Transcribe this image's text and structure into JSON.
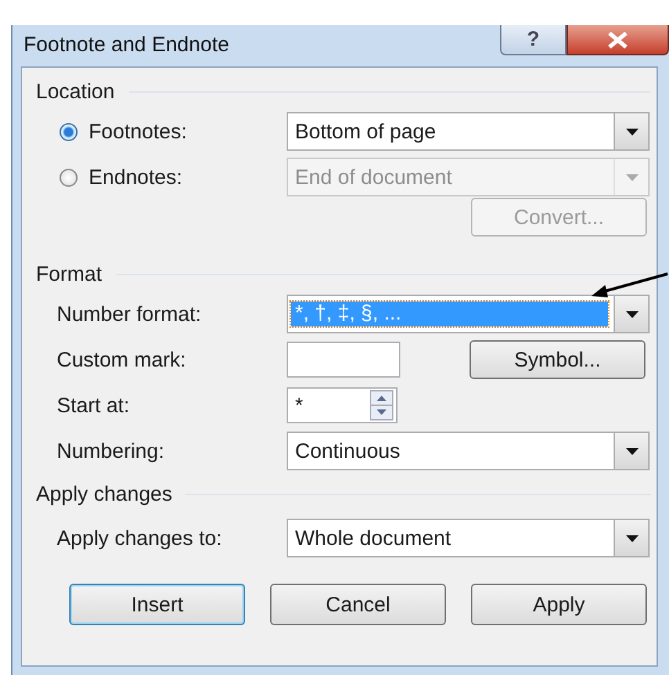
{
  "window": {
    "title": "Footnote and Endnote",
    "help_label": "?"
  },
  "location": {
    "legend": "Location",
    "rows": [
      {
        "kind": "radio",
        "label": "Footnotes:",
        "selected": true,
        "value": "Bottom of page",
        "disabled": false
      },
      {
        "kind": "radio",
        "label": "Endnotes:",
        "selected": false,
        "value": "End of document",
        "disabled": true
      }
    ],
    "convert_button": {
      "label": "Convert...",
      "disabled": true
    }
  },
  "format": {
    "legend": "Format",
    "rows": [
      {
        "kind": "dropdown",
        "label": "Number format:",
        "value": "*, †, ‡, §, ...",
        "focused": true
      },
      {
        "kind": "text",
        "label": "Custom mark:",
        "button": {
          "label": "Symbol..."
        }
      },
      {
        "kind": "spinner",
        "label": "Start at:",
        "value": "*"
      },
      {
        "kind": "dropdown",
        "label": "Numbering:",
        "value": "Continuous",
        "focused": false
      }
    ]
  },
  "apply": {
    "legend": "Apply changes",
    "rows": [
      {
        "kind": "dropdown",
        "label": "Apply changes to:",
        "value": "Whole document",
        "focused": false
      }
    ]
  },
  "buttons": [
    {
      "label": "Insert",
      "default": true
    },
    {
      "label": "Cancel",
      "default": false
    },
    {
      "label": "Apply",
      "default": false
    }
  ]
}
